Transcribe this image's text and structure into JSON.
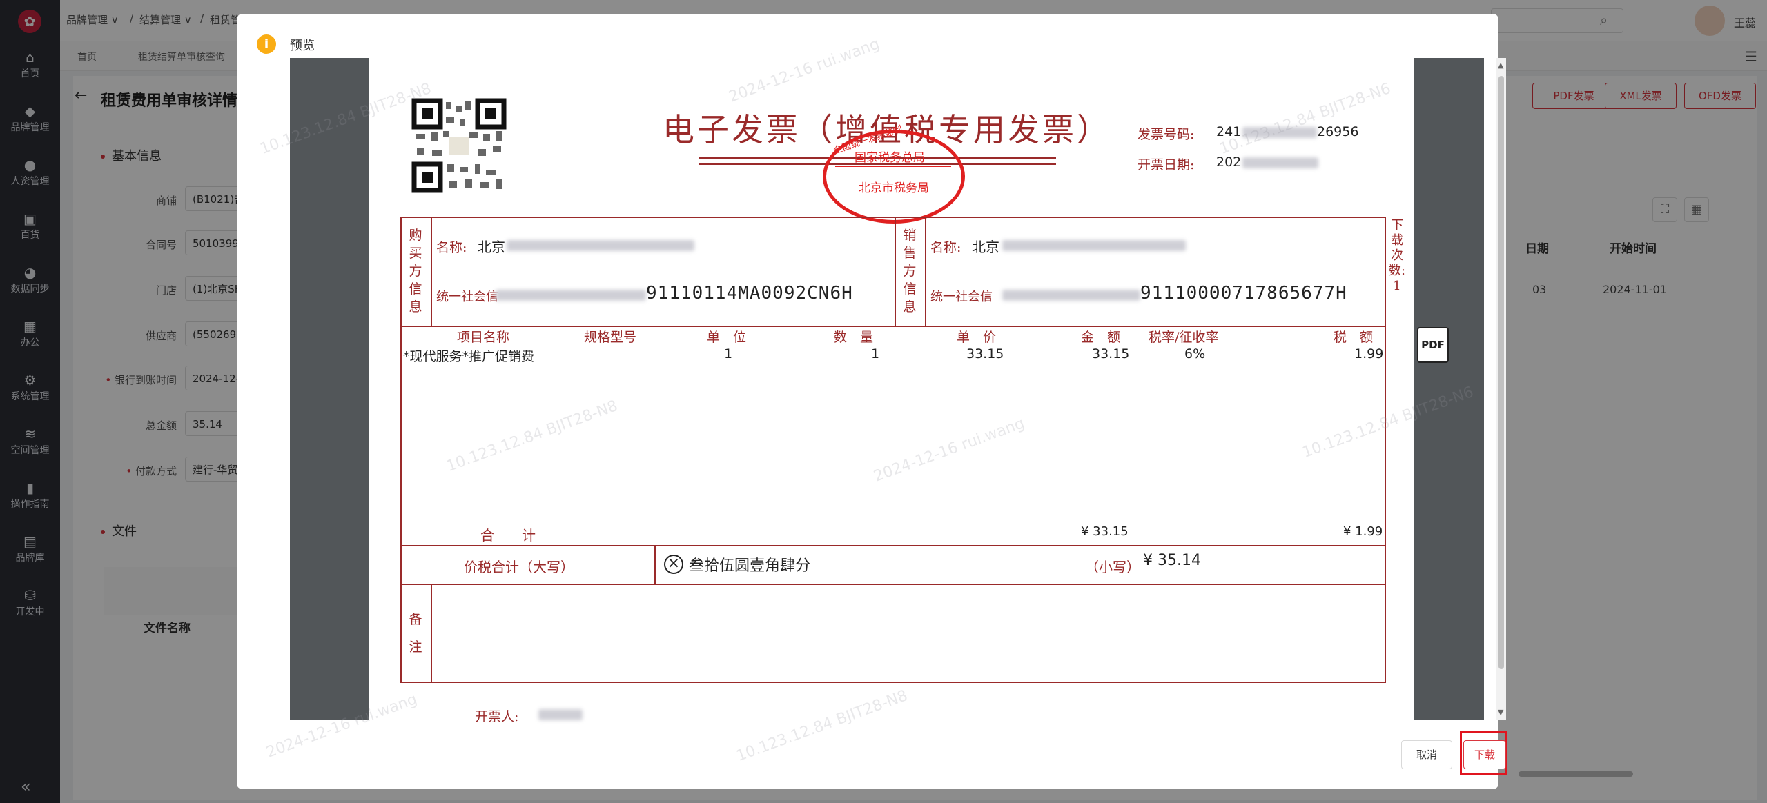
{
  "sidebar": {
    "items": [
      {
        "label": "首页",
        "icon": "home-icon"
      },
      {
        "label": "品牌管理",
        "icon": "diamond-icon"
      },
      {
        "label": "人资管理",
        "icon": "person-icon"
      },
      {
        "label": "百货",
        "icon": "bag-icon"
      },
      {
        "label": "数据同步",
        "icon": "pie-icon"
      },
      {
        "label": "办公",
        "icon": "grid-icon"
      },
      {
        "label": "系统管理",
        "icon": "gear-icon"
      },
      {
        "label": "空间管理",
        "icon": "layers-icon"
      },
      {
        "label": "操作指南",
        "icon": "book-icon"
      },
      {
        "label": "品牌库",
        "icon": "store-icon"
      },
      {
        "label": "开发中",
        "icon": "database-icon"
      }
    ],
    "collapse": "«"
  },
  "topbar": {
    "breadcrumbs": [
      "品牌管理 ∨",
      "/",
      "结算管理 ∨",
      "/",
      "租赁管"
    ],
    "user": "王蕊"
  },
  "tabs": [
    "首页",
    "租赁结算单审核查询"
  ],
  "page": {
    "title": "租赁费用单审核详情",
    "section_basic": "基本信息",
    "section_files": "文件",
    "fields": [
      {
        "label": "商铺",
        "value": "(B1021)吉",
        "required": false
      },
      {
        "label": "合同号",
        "value": "5010399",
        "required": false
      },
      {
        "label": "门店",
        "value": "(1)北京SK",
        "required": false
      },
      {
        "label": "供应商",
        "value": "(550269)",
        "required": false
      },
      {
        "label": "银行到账时间",
        "value": "2024-12-",
        "required": true
      },
      {
        "label": "总金额",
        "value": "35.14",
        "required": false
      },
      {
        "label": "付款方式",
        "value": "建行-华贸",
        "required": true
      }
    ],
    "file_column": "文件名称",
    "actions": [
      "PDF发票",
      "XML发票",
      "OFD发票"
    ],
    "table_headers": [
      "日期",
      "开始时间"
    ],
    "table_row": [
      "03",
      "2024-11-01"
    ]
  },
  "modal": {
    "title": "预览",
    "cancel": "取消",
    "download": "下载"
  },
  "invoice": {
    "title": "电子发票（增值税专用发票）",
    "stamp_top": "国家税务总局",
    "stamp_bottom": "北京市税务局",
    "stamp_arc": "全国统一发票监制",
    "number_label": "发票号码:",
    "number_prefix": "241",
    "number_suffix": "26956",
    "date_label": "开票日期:",
    "date_prefix": "202",
    "buyer_label": "购买方信息",
    "seller_label": "销售方信息",
    "name_label": "名称:",
    "buyer_name": "北京",
    "seller_name": "北京",
    "taxid_label": "统一社会信",
    "buyer_taxid_tail": "91110114MA0092CN6H",
    "seller_taxid_tail": "91110000717865677H",
    "download_count": "下载次数: 1",
    "columns": [
      "项目名称",
      "规格型号",
      "单　位",
      "数　量",
      "单　价",
      "金　额",
      "税率/征收率",
      "税　额"
    ],
    "item": {
      "name": "*现代服务*推广促销费",
      "spec": "",
      "unit": "1",
      "qty": "1",
      "price": "33.15",
      "amount": "33.15",
      "rate": "6%",
      "tax": "1.99"
    },
    "total_label": "合　　计",
    "total_amount": "¥ 33.15",
    "total_tax": "¥ 1.99",
    "caps_label": "价税合计（大写）",
    "caps_value": "叁拾伍圆壹角肆分",
    "small_label": "（小写）",
    "small_value": "¥  35.14",
    "remark_label": "备注",
    "issuer_label": "开票人:",
    "pdf_icon": "PDF"
  },
  "watermarks": [
    "10.123.12.84  BJIT28-N8",
    "2024-12-16  rui.wang",
    "10.123.12.84  BJIT28-N6"
  ],
  "colors": {
    "accent": "#d9363e",
    "invoice": "#9a2a2a",
    "stamp": "#e02020",
    "warning": "#faad14"
  }
}
